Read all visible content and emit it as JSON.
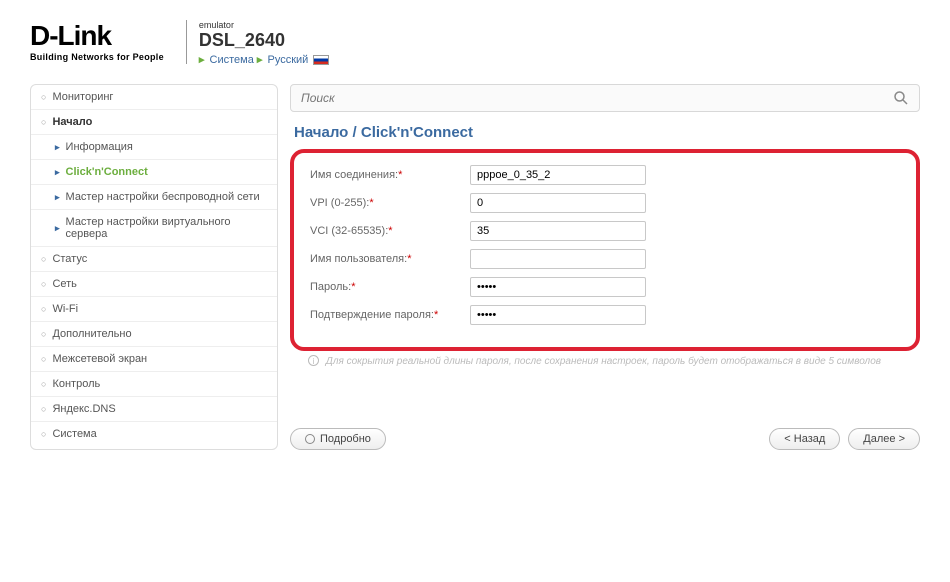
{
  "header": {
    "logo_main": "D-Link",
    "logo_sub": "Building Networks for People",
    "emulator": "emulator",
    "model": "DSL_2640",
    "crumb_system": "Система",
    "crumb_lang": "Русский"
  },
  "sidebar": {
    "items": [
      {
        "label": "Мониторинг",
        "type": "bullet"
      },
      {
        "label": "Начало",
        "type": "bullet",
        "open": true
      },
      {
        "label": "Информация",
        "type": "chev",
        "sub": true
      },
      {
        "label": "Click'n'Connect",
        "type": "chev",
        "sub": true,
        "active": true
      },
      {
        "label": "Мастер настройки беспроводной сети",
        "type": "chev",
        "sub": true
      },
      {
        "label": "Мастер настройки виртуального сервера",
        "type": "chev",
        "sub": true
      },
      {
        "label": "Статус",
        "type": "bullet"
      },
      {
        "label": "Сеть",
        "type": "bullet"
      },
      {
        "label": "Wi-Fi",
        "type": "bullet"
      },
      {
        "label": "Дополнительно",
        "type": "bullet"
      },
      {
        "label": "Межсетевой экран",
        "type": "bullet"
      },
      {
        "label": "Контроль",
        "type": "bullet"
      },
      {
        "label": "Яндекс.DNS",
        "type": "bullet"
      },
      {
        "label": "Система",
        "type": "bullet"
      }
    ]
  },
  "search": {
    "placeholder": "Поиск"
  },
  "breadcrumb": {
    "root": "Начало",
    "sep": "/",
    "page": "Click'n'Connect"
  },
  "form": {
    "fields": [
      {
        "label": "Имя соединения:",
        "value": "pppoe_0_35_2",
        "type": "text"
      },
      {
        "label": "VPI (0-255):",
        "value": "0",
        "type": "text"
      },
      {
        "label": "VCI (32-65535):",
        "value": "35",
        "type": "text"
      },
      {
        "label": "Имя пользователя:",
        "value": "",
        "type": "text"
      },
      {
        "label": "Пароль:",
        "value": "•••••",
        "type": "text"
      },
      {
        "label": "Подтверждение пароля:",
        "value": "•••••",
        "type": "text"
      }
    ],
    "hint": "Для сокрытия реальной длины пароля, после сохранения настроек, пароль будет отображаться в виде 5 символов"
  },
  "buttons": {
    "details": "Подробно",
    "back": "< Назад",
    "next": "Далее >"
  }
}
